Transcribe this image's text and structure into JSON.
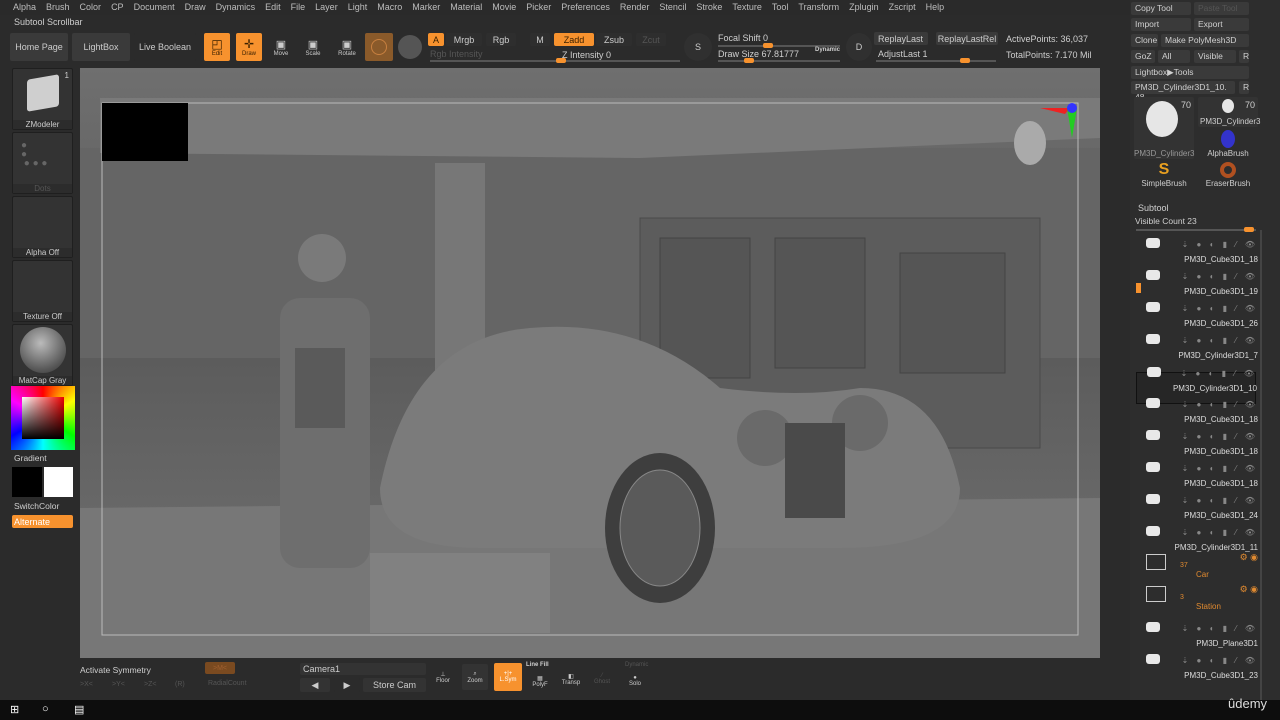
{
  "menu": [
    "Alpha",
    "Brush",
    "Color",
    "CP",
    "Document",
    "Draw",
    "Dynamics",
    "Edit",
    "File",
    "Layer",
    "Light",
    "Macro",
    "Marker",
    "Material",
    "Movie",
    "Picker",
    "Preferences",
    "Render",
    "Stencil",
    "Stroke",
    "Texture",
    "Tool",
    "Transform",
    "Zplugin",
    "Zscript",
    "Help"
  ],
  "subtool_scrollbar": "Subtool Scrollbar",
  "toolbar": {
    "home_page": "Home Page",
    "lightbox": "LightBox",
    "live_boolean": "Live Boolean",
    "edit": "Edit",
    "draw": "Draw",
    "move": "Move",
    "scale": "Scale",
    "rotate": "Rotate",
    "a": "A",
    "mrgb": "Mrgb",
    "rgb": "Rgb",
    "m": "M",
    "zadd": "Zadd",
    "zsub": "Zsub",
    "zcut": "Zcut",
    "rgb_intensity": "Rgb Intensity",
    "z_intensity": "Z Intensity 0",
    "focal_shift": "Focal Shift 0",
    "draw_size": "Draw Size 67.81777",
    "dynamic": "Dynamic",
    "replay_last": "ReplayLast",
    "replay_last_rel": "ReplayLastRel",
    "adjust_last": "AdjustLast 1",
    "active_points": "ActivePoints: 36,037",
    "total_points": "TotalPoints: 7.170 Mil"
  },
  "left_shelf": {
    "brush": "ZModeler",
    "brush_count": "1",
    "stroke": "Dots",
    "alpha": "Alpha Off",
    "texture": "Texture Off",
    "material": "MatCap Gray",
    "gradient": "Gradient",
    "switch_color": "SwitchColor",
    "alternate": "Alternate"
  },
  "tool_panel": {
    "copy_tool": "Copy Tool",
    "paste_tool": "Paste Tool",
    "import": "Import",
    "export": "Export",
    "clone": "Clone",
    "make_polymesh": "Make PolyMesh3D",
    "goz": "GoZ",
    "all": "All",
    "visible": "Visible",
    "r": "R",
    "lightbox_tools": "Lightbox▶Tools",
    "current_tool": "PM3D_Cylinder3D1_10. 48",
    "tools": [
      {
        "name": "PM3D_Cylinder3",
        "count": "70"
      },
      {
        "name": "PM3D_Cylinder3",
        "count": "70"
      },
      {
        "name": "AlphaBrush"
      },
      {
        "name": "SimpleBrush"
      },
      {
        "name": "EraserBrush"
      }
    ]
  },
  "subtool": {
    "title": "Subtool",
    "visible_count": "Visible Count 23",
    "items": [
      {
        "name": "PM3D_Cube3D1_18"
      },
      {
        "name": "PM3D_Cube3D1_19"
      },
      {
        "name": "PM3D_Cube3D1_26"
      },
      {
        "name": "PM3D_Cylinder3D1_7"
      },
      {
        "name": "PM3D_Cylinder3D1_10",
        "selected": true
      },
      {
        "name": "PM3D_Cube3D1_18"
      },
      {
        "name": "PM3D_Cube3D1_18"
      },
      {
        "name": "PM3D_Cube3D1_18"
      },
      {
        "name": "PM3D_Cube3D1_24"
      },
      {
        "name": "PM3D_Cylinder3D1_11"
      }
    ],
    "folders": [
      {
        "name": "Car",
        "count": "37"
      },
      {
        "name": "Station",
        "count": "3"
      }
    ],
    "items2": [
      {
        "name": "PM3D_Plane3D1"
      },
      {
        "name": "PM3D_Cube3D1_23"
      }
    ]
  },
  "bottom": {
    "activate_symmetry": "Activate Symmetry",
    "x": ">X<",
    "y": ">Y<",
    "z": ">Z<",
    "r": "(R)",
    "m": ">M<",
    "radial_count": "RadialCount",
    "camera": "Camera1",
    "store_cam": "Store Cam",
    "floor": "Floor",
    "zoom": "Zoom",
    "lsym": "L.Sym",
    "line_fill": "Line Fill",
    "polyf": "PolyF",
    "transp": "Transp",
    "ghost": "Ghost",
    "dynamic": "Dynamic",
    "solo": "Solo"
  },
  "watermark": "ûdemy",
  "colors": {
    "accent": "#f7922e",
    "bg": "#2b2b2b"
  }
}
